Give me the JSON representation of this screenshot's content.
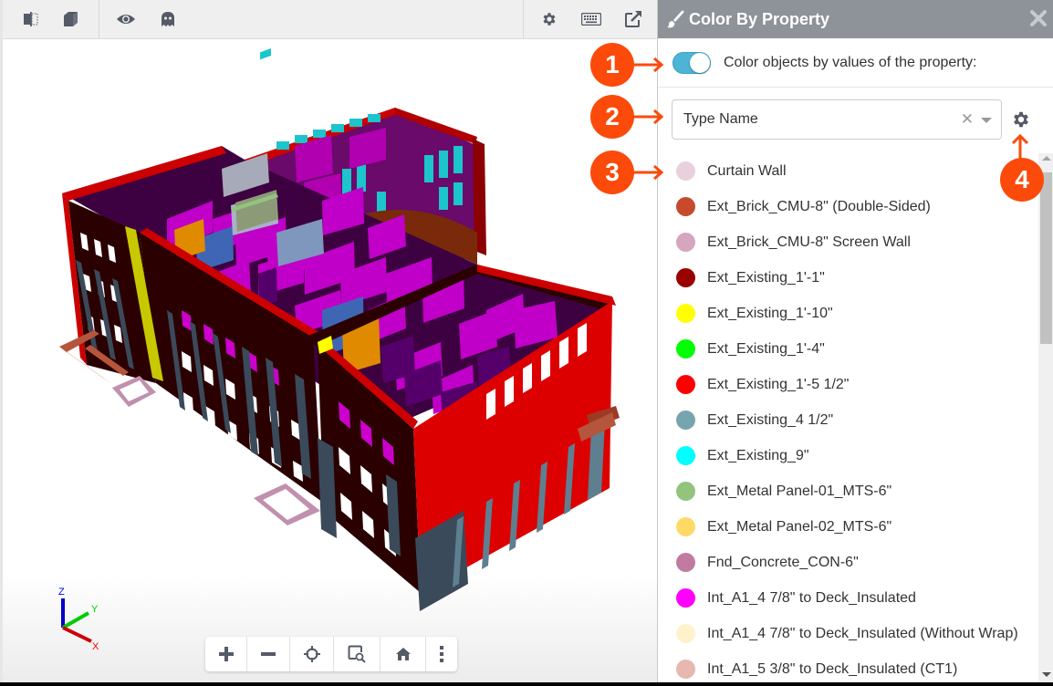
{
  "viewer": {
    "toolbar_left": [
      {
        "icon": "section-box-icon",
        "tooltip": "Section"
      },
      {
        "icon": "cube-icon",
        "tooltip": "View"
      },
      {
        "icon": "eye-icon",
        "tooltip": "Visibility"
      },
      {
        "icon": "ghost-icon",
        "tooltip": "Ghosting"
      }
    ],
    "toolbar_right": [
      {
        "icon": "gear-icon"
      },
      {
        "icon": "keyboard-icon"
      },
      {
        "icon": "external-link-icon"
      }
    ],
    "nav_buttons": [
      {
        "icon": "plus-icon",
        "label": "Zoom in"
      },
      {
        "icon": "minus-icon",
        "label": "Zoom out"
      },
      {
        "icon": "crosshair-icon",
        "label": "Focus"
      },
      {
        "icon": "zoom-window-icon",
        "label": "Zoom window"
      },
      {
        "icon": "home-icon",
        "label": "Home"
      },
      {
        "icon": "more-vertical-icon",
        "label": "More"
      }
    ],
    "axes": {
      "x": "X",
      "y": "Y",
      "z": "Z"
    }
  },
  "panel": {
    "title": "Color By Property",
    "toggle_label": "Color objects by values of the property:",
    "toggle_on": true,
    "property_select": {
      "value": "Type Name"
    },
    "legend": [
      {
        "label": "Curtain Wall",
        "color": "#e8d0dc"
      },
      {
        "label": "Ext_Brick_CMU-8\" (Double-Sided)",
        "color": "#c84a2d"
      },
      {
        "label": "Ext_Brick_CMU-8\" Screen Wall",
        "color": "#d5a6bd"
      },
      {
        "label": "Ext_Existing_1'-1\"",
        "color": "#990000"
      },
      {
        "label": "Ext_Existing_1'-10\"",
        "color": "#ffff00"
      },
      {
        "label": "Ext_Existing_1'-4\"",
        "color": "#00ff00"
      },
      {
        "label": "Ext_Existing_1'-5 1/2\"",
        "color": "#ff0000"
      },
      {
        "label": "Ext_Existing_4 1/2\"",
        "color": "#76a5af"
      },
      {
        "label": "Ext_Existing_9\"",
        "color": "#00ffff"
      },
      {
        "label": "Ext_Metal Panel-01_MTS-6\"",
        "color": "#93c47d"
      },
      {
        "label": "Ext_Metal Panel-02_MTS-6\"",
        "color": "#ffd966"
      },
      {
        "label": "Fnd_Concrete_CON-6\"",
        "color": "#c27ba0"
      },
      {
        "label": "Int_A1_4 7/8\" to Deck_Insulated",
        "color": "#ff00ff"
      },
      {
        "label": "Int_A1_4 7/8\" to Deck_Insulated (Without Wrap)",
        "color": "#fff2cc"
      },
      {
        "label": "Int_A1_5 3/8\" to Deck_Insulated (CT1)",
        "color": "#e6b8af"
      }
    ]
  },
  "callouts": [
    "1",
    "2",
    "3",
    "4"
  ],
  "colors": {
    "accent": "#fc4a0b",
    "toggle": "#4db4d6",
    "header": "#8e9299"
  }
}
